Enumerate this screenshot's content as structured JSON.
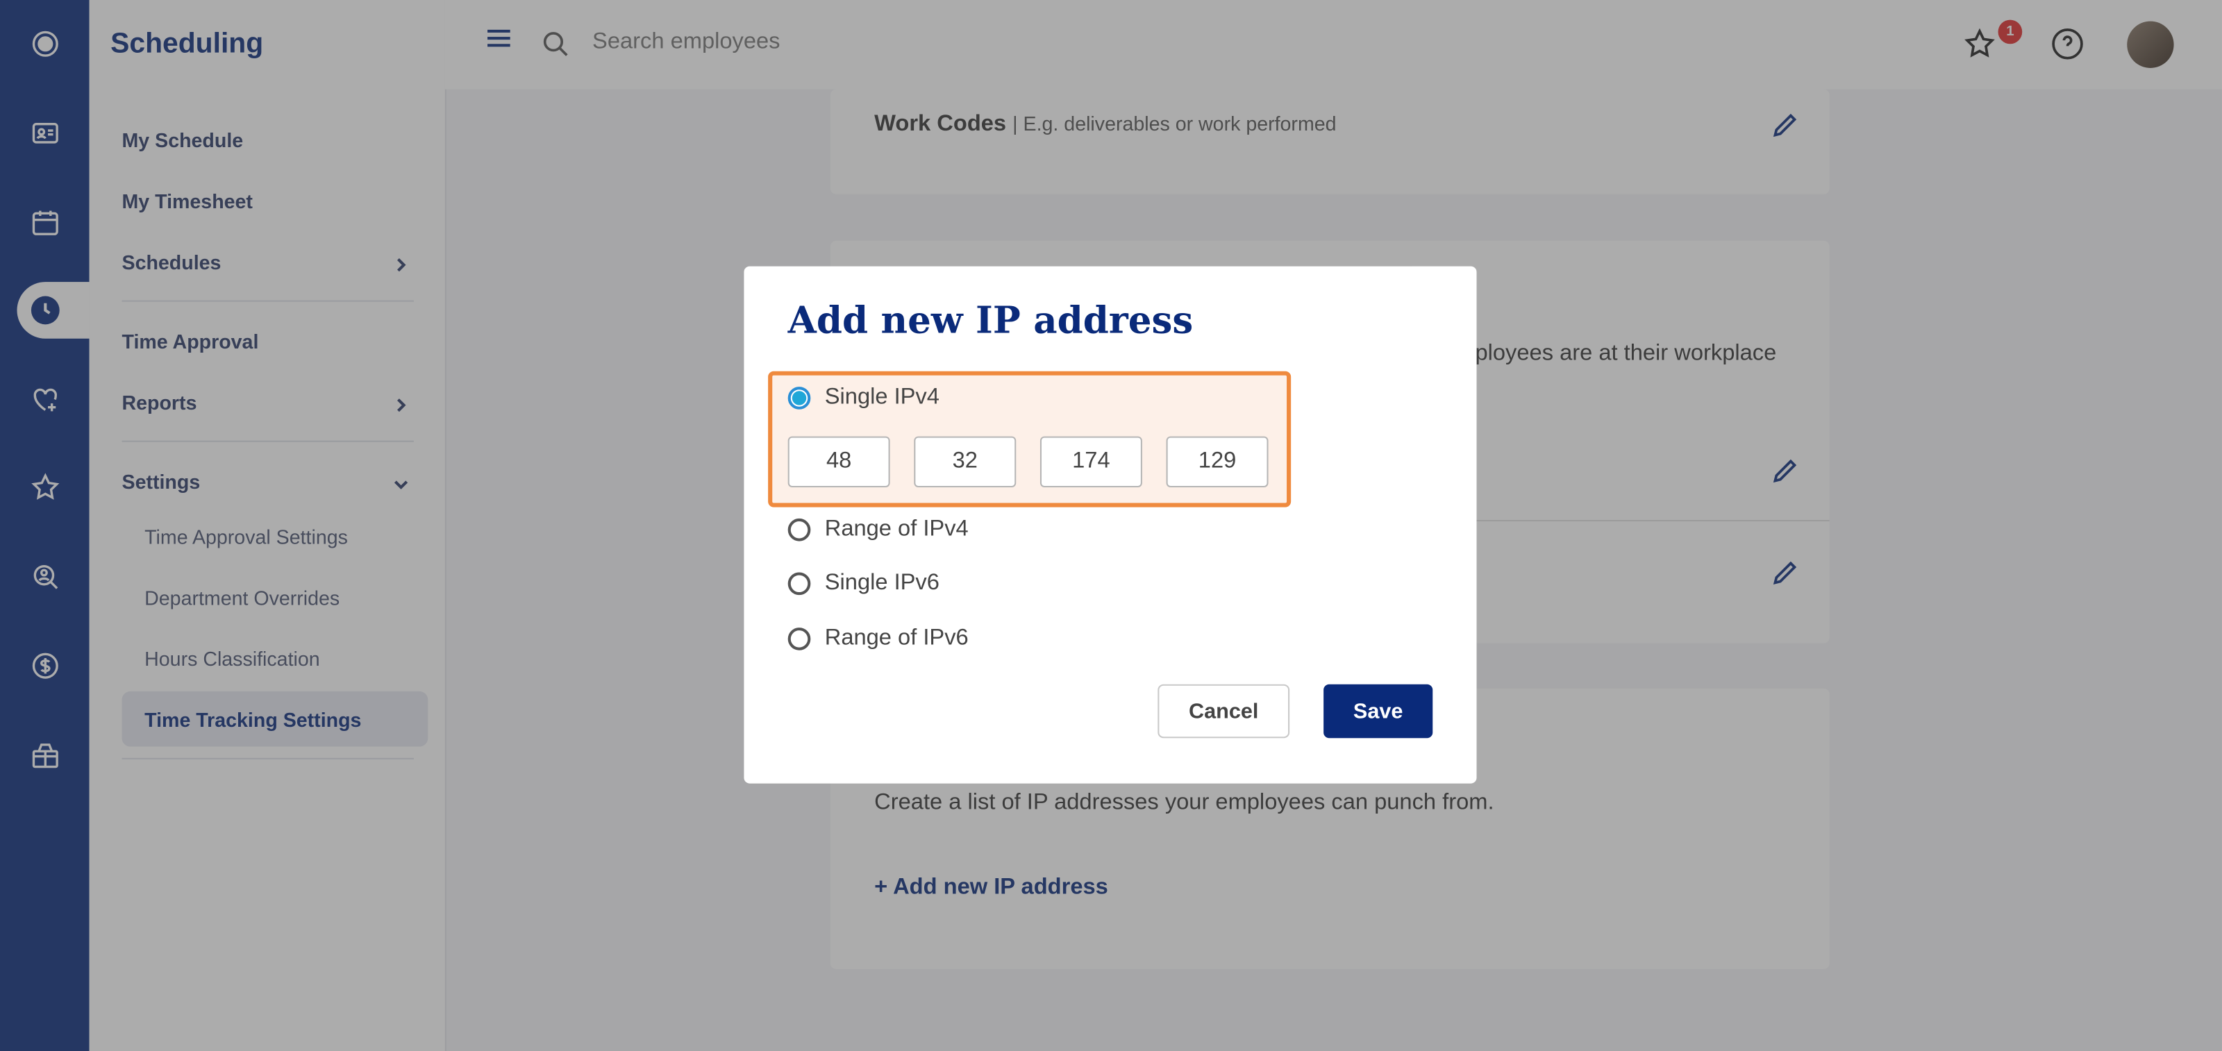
{
  "app": {
    "title": "Scheduling"
  },
  "topbar": {
    "search_placeholder": "Search employees",
    "notification_count": "1"
  },
  "sidebar": {
    "items": [
      {
        "label": "My Schedule"
      },
      {
        "label": "My Timesheet"
      },
      {
        "label": "Schedules"
      },
      {
        "label": "Time Approval"
      },
      {
        "label": "Reports"
      },
      {
        "label": "Settings"
      }
    ],
    "settings_sub": [
      {
        "label": "Time Approval Settings"
      },
      {
        "label": "Department Overrides"
      },
      {
        "label": "Hours Classification"
      },
      {
        "label": "Time Tracking Settings"
      }
    ]
  },
  "main": {
    "work_codes_title": "Work Codes",
    "work_codes_desc": "| E.g. deliverables or work performed",
    "location_desc_fragment": "ployees are at their workplace",
    "ip_desc": "Create a list of IP addresses your employees can punch from.",
    "add_ip_link": "+ Add new IP address"
  },
  "modal": {
    "title": "Add new IP address",
    "options": [
      {
        "label": "Single IPv4",
        "selected": true
      },
      {
        "label": "Range of IPv4",
        "selected": false
      },
      {
        "label": "Single IPv6",
        "selected": false
      },
      {
        "label": "Range of IPv6",
        "selected": false
      }
    ],
    "octets": [
      "48",
      "32",
      "174",
      "129"
    ],
    "cancel_label": "Cancel",
    "save_label": "Save"
  },
  "colors": {
    "brand": "#0a2a7a",
    "highlight_border": "#ef8a3e",
    "radio_active": "#1fa7d8",
    "badge": "#e02c2c"
  }
}
